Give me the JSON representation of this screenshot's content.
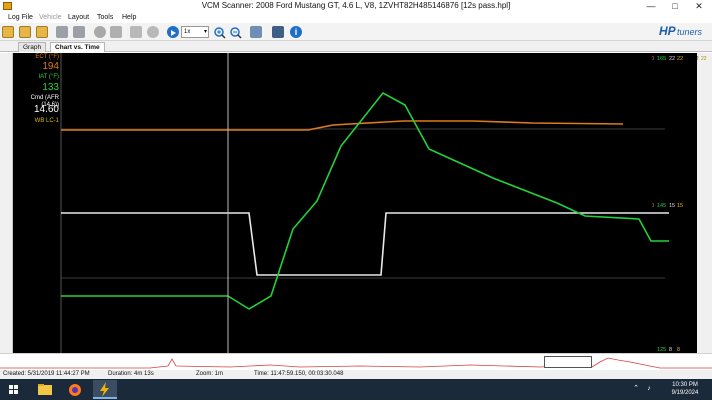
{
  "window": {
    "title": "VCM Scanner: 2008 Ford Mustang GT, 4.6 L, V8, 1ZVHT82H485146876 [12s pass.hpl]"
  },
  "menu": [
    {
      "label": "Log File",
      "enabled": true
    },
    {
      "label": "Vehicle",
      "enabled": false
    },
    {
      "label": "Layout",
      "enabled": true
    },
    {
      "label": "Tools",
      "enabled": true
    },
    {
      "label": "Help",
      "enabled": true
    }
  ],
  "toolbar": {
    "speed": "1x",
    "logo_hp": "HP",
    "logo_tuners": "tuners",
    "icons": [
      "open-folder-icon",
      "open-log-icon",
      "save-log-icon",
      "vehicle-icon",
      "vehicle-connect-icon",
      "record-icon",
      "stop-icon",
      "channels-icon",
      "settings-icon",
      "play-icon",
      "zoom-in-icon",
      "zoom-out-icon",
      "layout-icon",
      "save-icon",
      "info-icon"
    ]
  },
  "tabs": [
    {
      "label": "Graph",
      "active": false
    },
    {
      "label": "Chart vs. Time",
      "active": true
    }
  ],
  "channels": [
    {
      "name": "ECT (°F)",
      "value": "194",
      "color": "#e07a1c"
    },
    {
      "name": "IAT (°F)",
      "value": "133",
      "color": "#22d23a"
    },
    {
      "name": "Cmd (AFR (14.6))",
      "value": "14.60",
      "color": "#ffffff"
    },
    {
      "name": "WB LC-1",
      "value": "",
      "color": "#e0b800"
    }
  ],
  "right_scale": {
    "top": [
      "240",
      "165",
      "22",
      "22"
    ],
    "mid": [
      "150",
      "145",
      "15",
      "15"
    ],
    "bottom": [
      "60",
      "125",
      "8",
      "8"
    ]
  },
  "colors": {
    "ect": "#e07a1c",
    "iat": "#22d23a",
    "afr": "#e8e8e8",
    "cursor": "#bdbdbd",
    "grid": "#3a3a3a"
  },
  "status": {
    "created": "Created: 5/31/2019 11:44:27 PM",
    "duration": "Duration: 4m 13s",
    "zoom": "Zoom: 1m",
    "time": "Time: 11:47:59.150, 00:03:30.048"
  },
  "taskbar": {
    "time": "10:30 PM",
    "date": "9/19/2024"
  }
}
